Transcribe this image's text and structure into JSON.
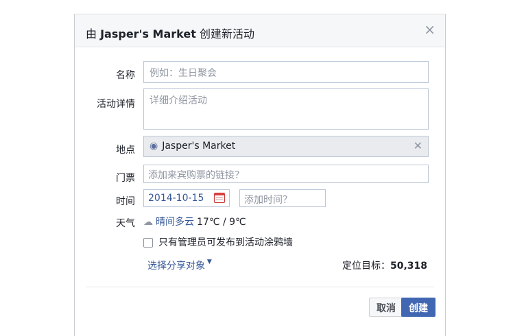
{
  "dialog": {
    "title_prefix": "由 ",
    "title_name": "Jasper's Market",
    "title_suffix": " 创建新活动",
    "close": "×"
  },
  "form": {
    "name_label": "名称",
    "name_placeholder": "例如：生日聚会",
    "details_label": "活动详情",
    "details_placeholder": "详细介绍活动",
    "location_label": "地点",
    "location_value": "Jasper's Market",
    "location_clear": "✕",
    "tickets_label": "门票",
    "tickets_placeholder": "添加来宾购票的链接？",
    "time_label": "时间",
    "date_value": "2014-10-15",
    "time_placeholder": "添加时间？",
    "weather_label": "天气",
    "weather_condition": "晴间多云",
    "weather_temps": "17℃ / 9℃",
    "admin_only_label": "只有管理员可发布到活动涂鸦墙"
  },
  "footer": {
    "share_label": "选择分享对象",
    "target_label": "定位目标：",
    "target_count": "50,318",
    "cancel_label": "取消",
    "create_label": "创建"
  },
  "colors": {
    "accent": "#4267b2",
    "link": "#365899",
    "location_bg": "#e9ebee"
  },
  "icons": {
    "location": "map-pin-icon",
    "calendar": "calendar-icon",
    "weather": "cloud-sun-icon",
    "close": "close-icon"
  }
}
